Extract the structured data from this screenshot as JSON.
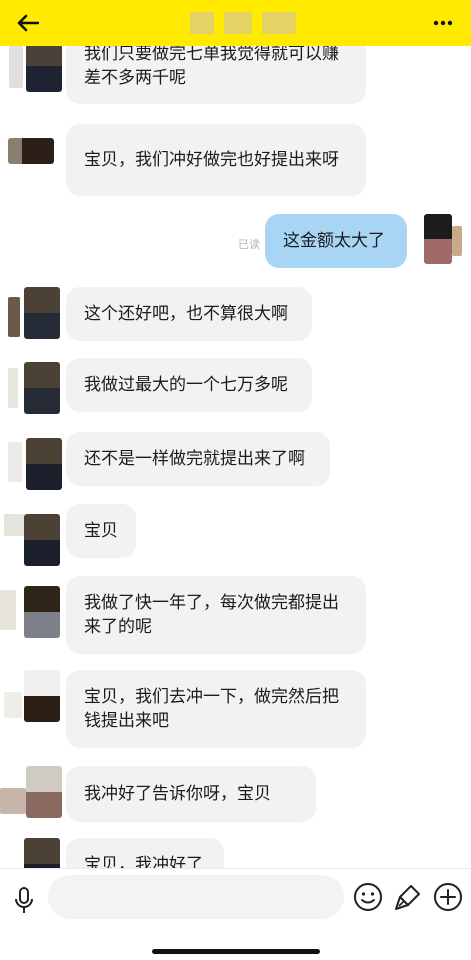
{
  "header": {
    "back_icon": "back-arrow-icon",
    "more_icon": "more-dots-icon",
    "title": ""
  },
  "messages": [
    {
      "side": "left",
      "text": "我们只要做完七单我觉得就可以赚差不多两千呢"
    },
    {
      "side": "left",
      "text": "宝贝，我们冲好做完也好提出来呀"
    },
    {
      "side": "right",
      "text": "这金额太大了",
      "status": "已读"
    },
    {
      "side": "left",
      "text": "这个还好吧，也不算很大啊"
    },
    {
      "side": "left",
      "text": "我做过最大的一个七万多呢"
    },
    {
      "side": "left",
      "text": "还不是一样做完就提出来了啊"
    },
    {
      "side": "left",
      "text": "宝贝"
    },
    {
      "side": "left",
      "text": "我做了快一年了，每次做完都提出来了的呢"
    },
    {
      "side": "left",
      "text": "宝贝，我们去冲一下，做完然后把钱提出来吧"
    },
    {
      "side": "left",
      "text": "我冲好了告诉你呀，宝贝"
    },
    {
      "side": "left",
      "text": "宝贝，我冲好了"
    }
  ],
  "input_bar": {
    "placeholder": "",
    "value": "",
    "mic_icon": "microphone-icon",
    "emoji_icon": "emoji-icon",
    "brush_icon": "brush-icon",
    "plus_icon": "plus-icon"
  },
  "colors": {
    "header_bg": "#ffea00",
    "incoming_bubble": "#f2f2f2",
    "outgoing_bubble": "#a9d5f5",
    "read_status": "#b5b5b5"
  }
}
